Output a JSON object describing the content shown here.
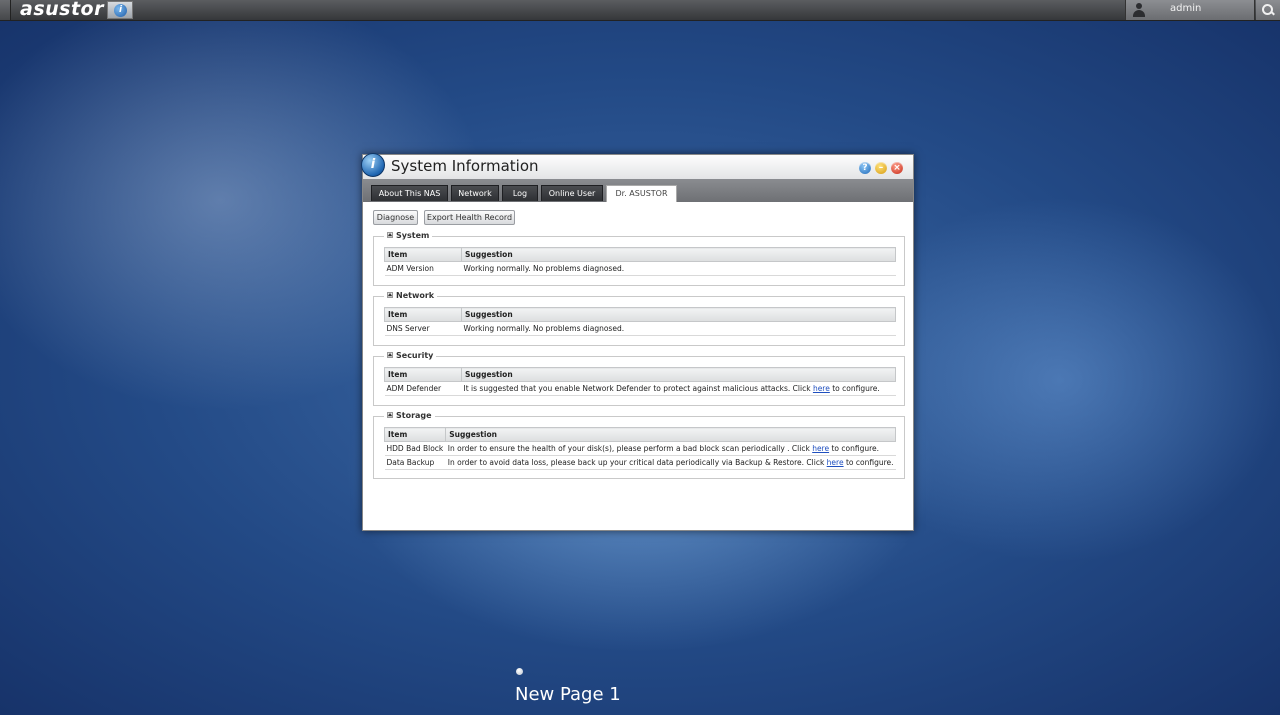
{
  "topbar": {
    "logo": "asustor",
    "user": "admin"
  },
  "window": {
    "title": "System Information",
    "tabs": [
      {
        "label": "About This NAS",
        "active": false
      },
      {
        "label": "Network",
        "active": false
      },
      {
        "label": "Log",
        "active": false
      },
      {
        "label": "Online User",
        "active": false
      },
      {
        "label": "Dr. ASUSTOR",
        "active": true
      }
    ],
    "buttons": {
      "diagnose": "Diagnose",
      "export": "Export Health Record"
    },
    "columns": {
      "item": "Item",
      "suggestion": "Suggestion"
    },
    "groups": [
      {
        "title": "System",
        "rows": [
          {
            "item": "ADM Version",
            "pre": "Working normally. No problems diagnosed.",
            "link": "",
            "post": ""
          }
        ]
      },
      {
        "title": "Network",
        "rows": [
          {
            "item": "DNS Server",
            "pre": "Working normally. No problems diagnosed.",
            "link": "",
            "post": ""
          }
        ]
      },
      {
        "title": "Security",
        "rows": [
          {
            "item": "ADM Defender",
            "pre": "It is suggested that you enable Network Defender to protect against malicious attacks. Click ",
            "link": "here",
            "post": " to configure."
          }
        ]
      },
      {
        "title": "Storage",
        "rows": [
          {
            "item": "HDD Bad Block",
            "pre": "In order to ensure the health of your disk(s), please perform a bad block scan periodically . Click ",
            "link": "here",
            "post": " to configure."
          },
          {
            "item": "Data Backup",
            "pre": "In order to avoid data loss, please back up your critical data periodically via Backup & Restore. Click ",
            "link": "here",
            "post": " to configure."
          }
        ]
      }
    ]
  },
  "desktop": {
    "page_label": "New Page 1"
  }
}
